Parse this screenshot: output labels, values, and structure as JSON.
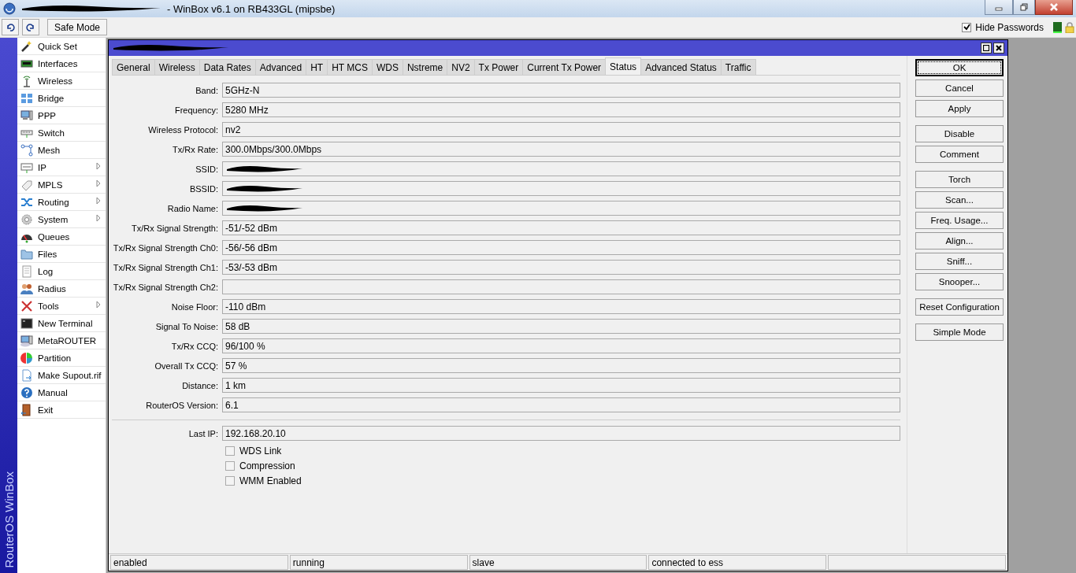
{
  "window": {
    "title": "- WinBox v6.1 on RB433GL (mipsbe)"
  },
  "toolbar": {
    "safe_mode": "Safe Mode",
    "hide_passwords": {
      "label": "Hide Passwords",
      "checked": true
    }
  },
  "side_label": "RouterOS WinBox",
  "menu": [
    {
      "label": "Quick Set",
      "submenu": false
    },
    {
      "label": "Interfaces",
      "submenu": false
    },
    {
      "label": "Wireless",
      "submenu": false
    },
    {
      "label": "Bridge",
      "submenu": false
    },
    {
      "label": "PPP",
      "submenu": false
    },
    {
      "label": "Switch",
      "submenu": false
    },
    {
      "label": "Mesh",
      "submenu": false
    },
    {
      "label": "IP",
      "submenu": true
    },
    {
      "label": "MPLS",
      "submenu": true
    },
    {
      "label": "Routing",
      "submenu": true
    },
    {
      "label": "System",
      "submenu": true
    },
    {
      "label": "Queues",
      "submenu": false
    },
    {
      "label": "Files",
      "submenu": false
    },
    {
      "label": "Log",
      "submenu": false
    },
    {
      "label": "Radius",
      "submenu": false
    },
    {
      "label": "Tools",
      "submenu": true
    },
    {
      "label": "New Terminal",
      "submenu": false
    },
    {
      "label": "MetaROUTER",
      "submenu": false
    },
    {
      "label": "Partition",
      "submenu": false
    },
    {
      "label": "Make Supout.rif",
      "submenu": false
    },
    {
      "label": "Manual",
      "submenu": false
    },
    {
      "label": "Exit",
      "submenu": false
    }
  ],
  "dialog": {
    "tabs": [
      {
        "label": "General",
        "selected": false
      },
      {
        "label": "Wireless",
        "selected": false
      },
      {
        "label": "Data Rates",
        "selected": false
      },
      {
        "label": "Advanced",
        "selected": false
      },
      {
        "label": "HT",
        "selected": false
      },
      {
        "label": "HT MCS",
        "selected": false
      },
      {
        "label": "WDS",
        "selected": false
      },
      {
        "label": "Nstreme",
        "selected": false
      },
      {
        "label": "NV2",
        "selected": false
      },
      {
        "label": "Tx Power",
        "selected": false
      },
      {
        "label": "Current Tx Power",
        "selected": false
      },
      {
        "label": "Status",
        "selected": true
      },
      {
        "label": "Advanced Status",
        "selected": false
      },
      {
        "label": "Traffic",
        "selected": false
      }
    ],
    "fields": [
      {
        "label": "Band:",
        "value": "5GHz-N",
        "redacted": false
      },
      {
        "label": "Frequency:",
        "value": "5280 MHz",
        "redacted": false
      },
      {
        "label": "Wireless Protocol:",
        "value": "nv2",
        "redacted": false
      },
      {
        "label": "Tx/Rx Rate:",
        "value": "300.0Mbps/300.0Mbps",
        "redacted": false
      },
      {
        "label": "SSID:",
        "redacted": true
      },
      {
        "label": "BSSID:",
        "redacted": true
      },
      {
        "label": "Radio Name:",
        "redacted": true
      },
      {
        "label": "Tx/Rx Signal Strength:",
        "value": "-51/-52 dBm",
        "redacted": false
      },
      {
        "label": "Tx/Rx Signal Strength Ch0:",
        "value": "-56/-56 dBm",
        "redacted": false
      },
      {
        "label": "Tx/Rx Signal Strength Ch1:",
        "value": "-53/-53 dBm",
        "redacted": false
      },
      {
        "label": "Tx/Rx Signal Strength Ch2:",
        "redacted": false
      },
      {
        "label": "Noise Floor:",
        "value": "-110 dBm",
        "redacted": false
      },
      {
        "label": "Signal To Noise:",
        "value": "58 dB",
        "redacted": false
      },
      {
        "label": "Tx/Rx CCQ:",
        "value": "96/100 %",
        "redacted": false
      },
      {
        "label": "Overall Tx CCQ:",
        "value": "57 %",
        "redacted": false
      },
      {
        "label": "Distance:",
        "value": "1 km",
        "redacted": false
      },
      {
        "label": "RouterOS Version:",
        "value": "6.1",
        "redacted": false
      }
    ],
    "last_ip": {
      "label": "Last IP:",
      "value": "192.168.20.10"
    },
    "checkboxes": [
      {
        "label": "WDS Link",
        "checked": false
      },
      {
        "label": "Compression",
        "checked": false
      },
      {
        "label": "WMM Enabled",
        "checked": false
      }
    ],
    "button_groups": [
      [
        {
          "label": "OK",
          "default": true
        },
        {
          "label": "Cancel",
          "default": false
        },
        {
          "label": "Apply",
          "default": false
        }
      ],
      [
        {
          "label": "Disable",
          "default": false
        },
        {
          "label": "Comment",
          "default": false
        }
      ],
      [
        {
          "label": "Torch",
          "default": false
        },
        {
          "label": "Scan...",
          "default": false
        },
        {
          "label": "Freq. Usage...",
          "default": false
        },
        {
          "label": "Align...",
          "default": false
        },
        {
          "label": "Sniff...",
          "default": false
        },
        {
          "label": "Snooper...",
          "default": false
        }
      ],
      [
        {
          "label": "Reset Configuration",
          "default": false
        }
      ],
      [
        {
          "label": "Simple Mode",
          "default": false
        }
      ]
    ],
    "status_bar": [
      "enabled",
      "running",
      "slave",
      "connected to ess"
    ]
  }
}
